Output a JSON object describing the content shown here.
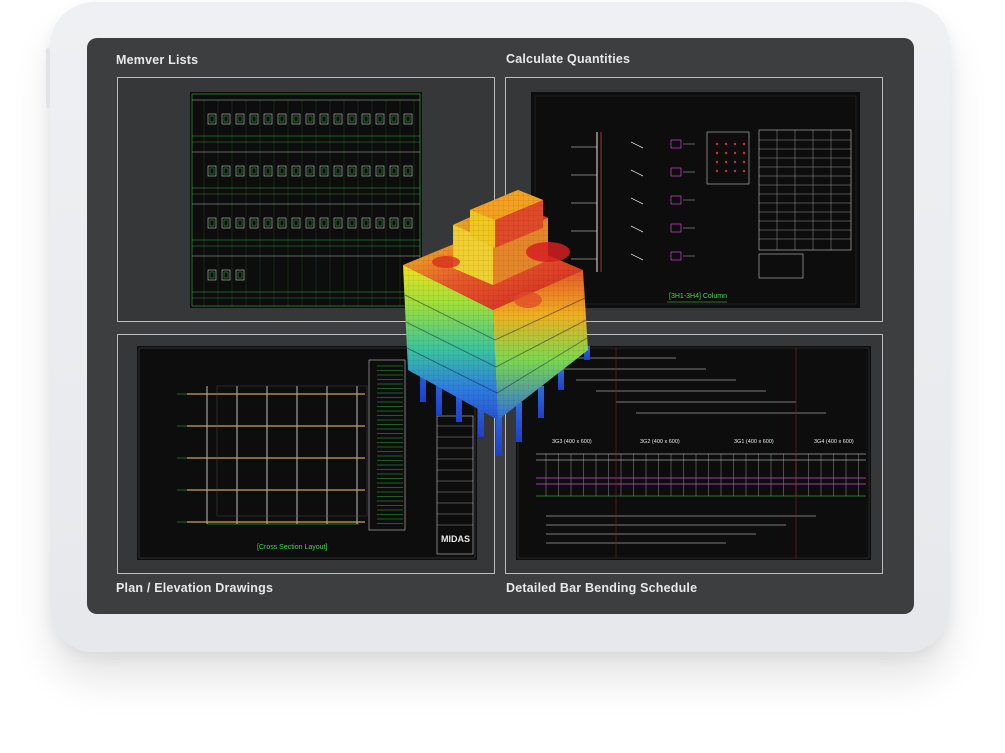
{
  "panels": {
    "member_lists": {
      "title": "Memver Lists"
    },
    "calculate_quantities": {
      "title": "Calculate Quantities",
      "drawing_caption": "[3H1-3H4] Column"
    },
    "plan_elevation": {
      "title": "Plan / Elevation Drawings",
      "drawing_caption": "[Cross Section Layout]",
      "logo_text": "MIDAS"
    },
    "bar_bending": {
      "title": "Detailed Bar Bending Schedule",
      "beam_labels": [
        "3G3 (400 x 600)",
        "3G2 (400 x 600)",
        "3G1 (400 x 600)",
        "3G4 (400 x 600)"
      ]
    }
  },
  "colors": {
    "cad_green": "#3ddc4f",
    "cad_white": "#e8e8e8",
    "cad_orange": "#d4a24a",
    "cad_magenta": "#d04bd0",
    "screen_bg": "#3d3e40"
  }
}
